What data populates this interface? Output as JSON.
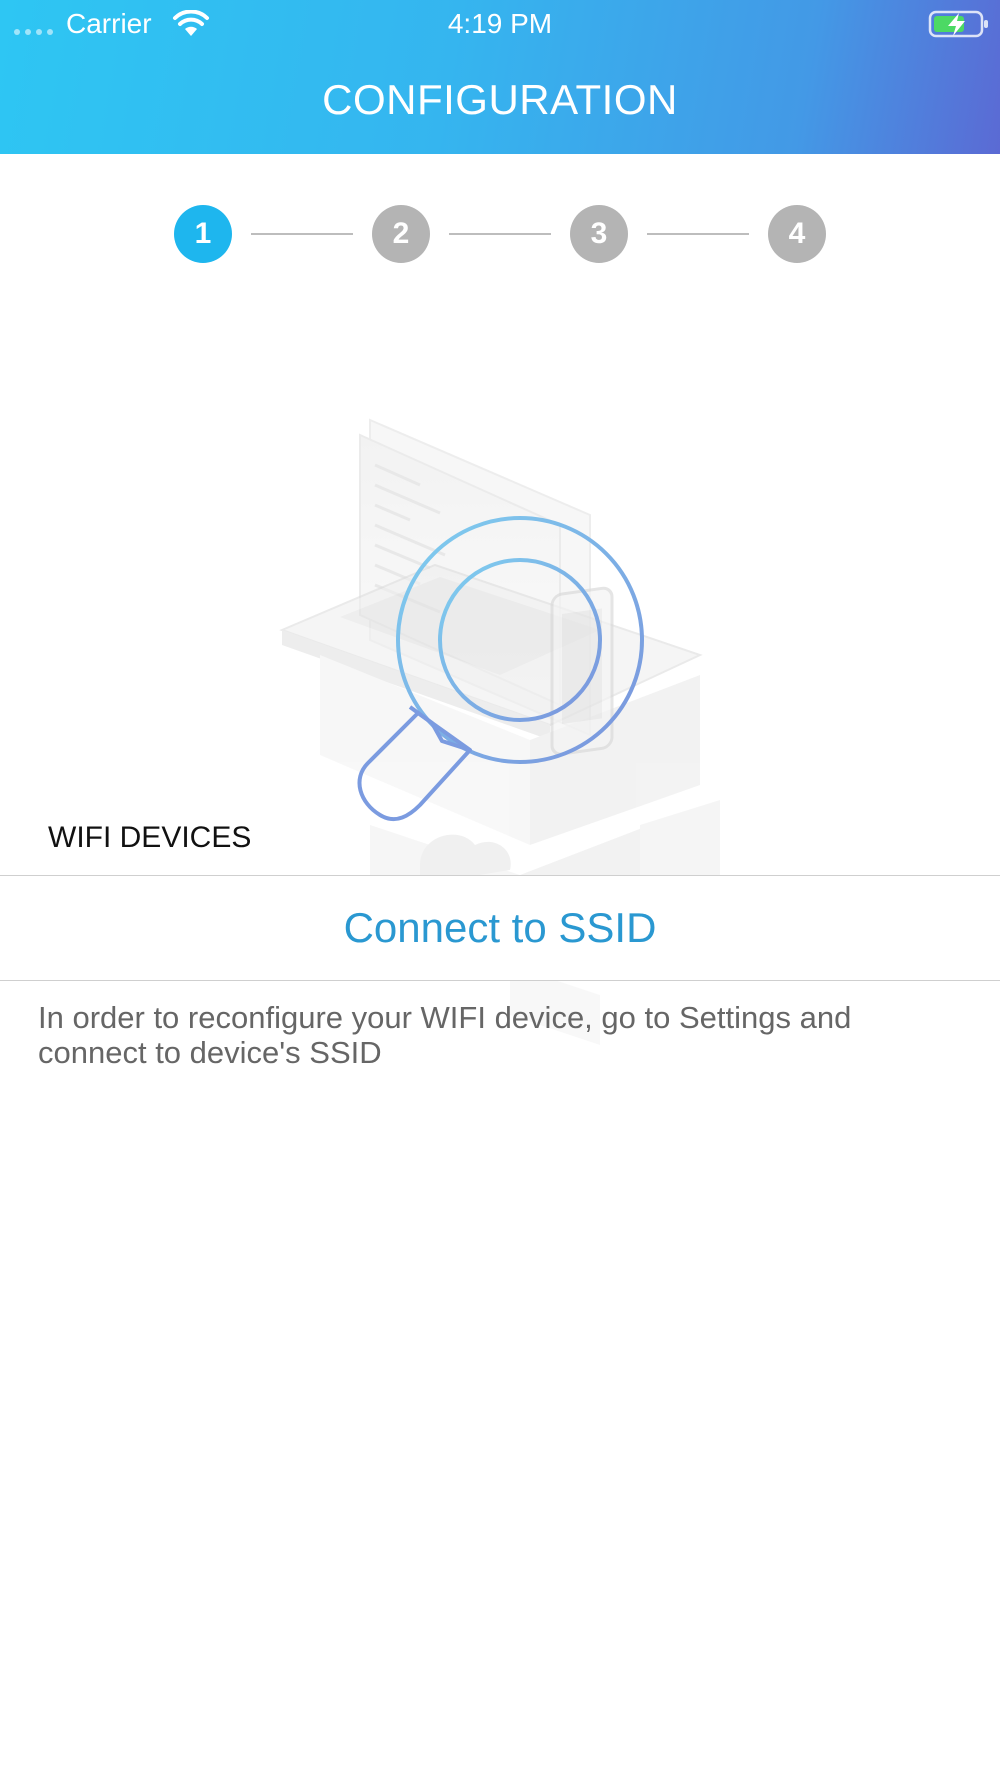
{
  "status_bar": {
    "carrier": "Carrier",
    "time": "4:19 PM",
    "signal_icon": "signal-dots-icon",
    "wifi_icon": "wifi-icon",
    "battery_icon": "battery-charging-icon"
  },
  "header": {
    "title": "CONFIGURATION",
    "gradient_colors": [
      "#2ec6f3",
      "#5b6ad4"
    ]
  },
  "stepper": {
    "steps": [
      {
        "label": "1",
        "active": true
      },
      {
        "label": "2",
        "active": false
      },
      {
        "label": "3",
        "active": false
      },
      {
        "label": "4",
        "active": false
      }
    ],
    "active_color": "#1eb6ee",
    "inactive_color": "#b4b4b4"
  },
  "illustration": {
    "icon": "device-search-illustration"
  },
  "section": {
    "label": "WIFI DEVICES"
  },
  "connect": {
    "label": "Connect to SSID",
    "color": "#2a98d1"
  },
  "help": {
    "text": "In order to reconfigure your WIFI device, go to Settings and connect to device's SSID"
  }
}
